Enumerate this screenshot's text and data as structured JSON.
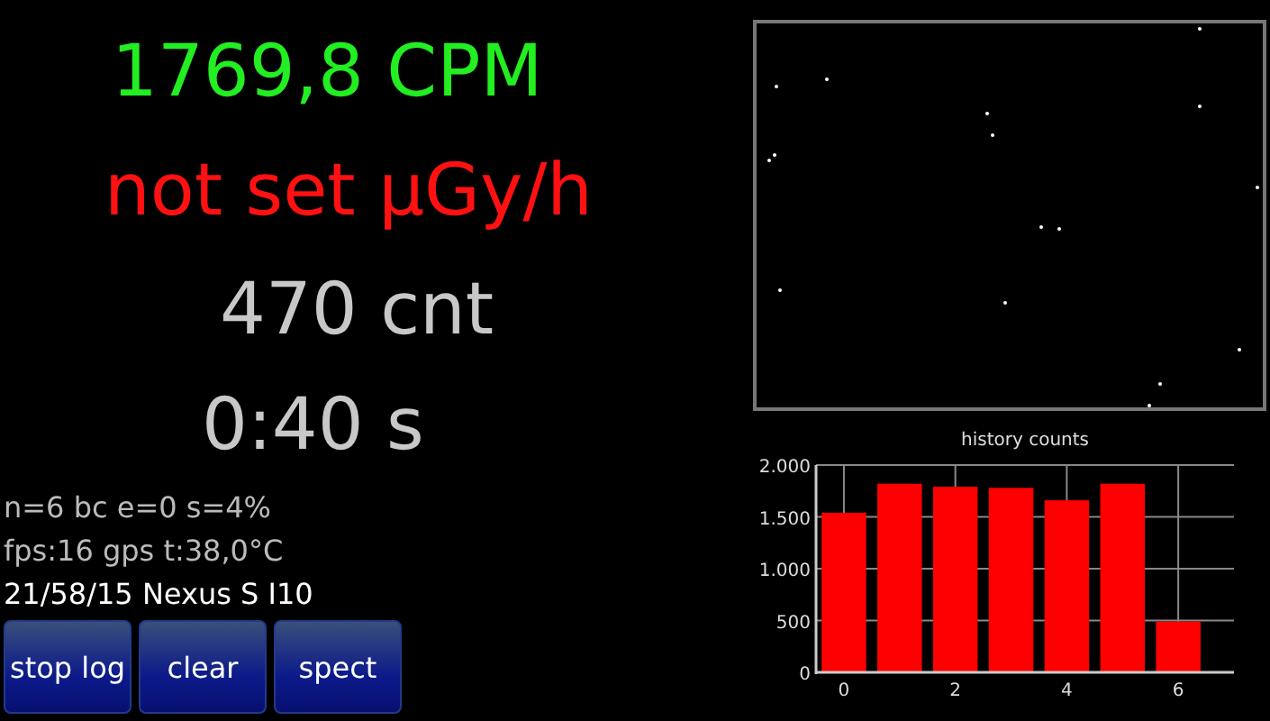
{
  "readings": {
    "rate": "1769,8 CPM",
    "dose": "not set µGy/h",
    "count": "470 cnt",
    "time": "0:40 s"
  },
  "status_lines": [
    "n=6 bc e=0 s=4%",
    "fps:16 gps t:38,0°C",
    "21/58/15 Nexus S I10"
  ],
  "buttons": [
    "stop log",
    "clear",
    "spect"
  ],
  "history_chart": {
    "chart_data": {
      "type": "bar",
      "grid": true,
      "title": "history counts",
      "x": [
        0,
        1,
        2,
        3,
        4,
        5,
        6
      ],
      "values": [
        1540,
        1820,
        1790,
        1780,
        1660,
        1820,
        490
      ],
      "xlim": [
        -0.5,
        7
      ],
      "ylim": [
        0,
        2000
      ],
      "xticks": [
        0,
        2,
        4,
        6
      ],
      "yticks": [
        {
          "value": 0,
          "label": "0"
        },
        {
          "value": 500,
          "label": "500"
        },
        {
          "value": 1000,
          "label": "1.000"
        },
        {
          "value": 1500,
          "label": "1.500"
        },
        {
          "value": 2000,
          "label": "2.000"
        }
      ]
    }
  }
}
